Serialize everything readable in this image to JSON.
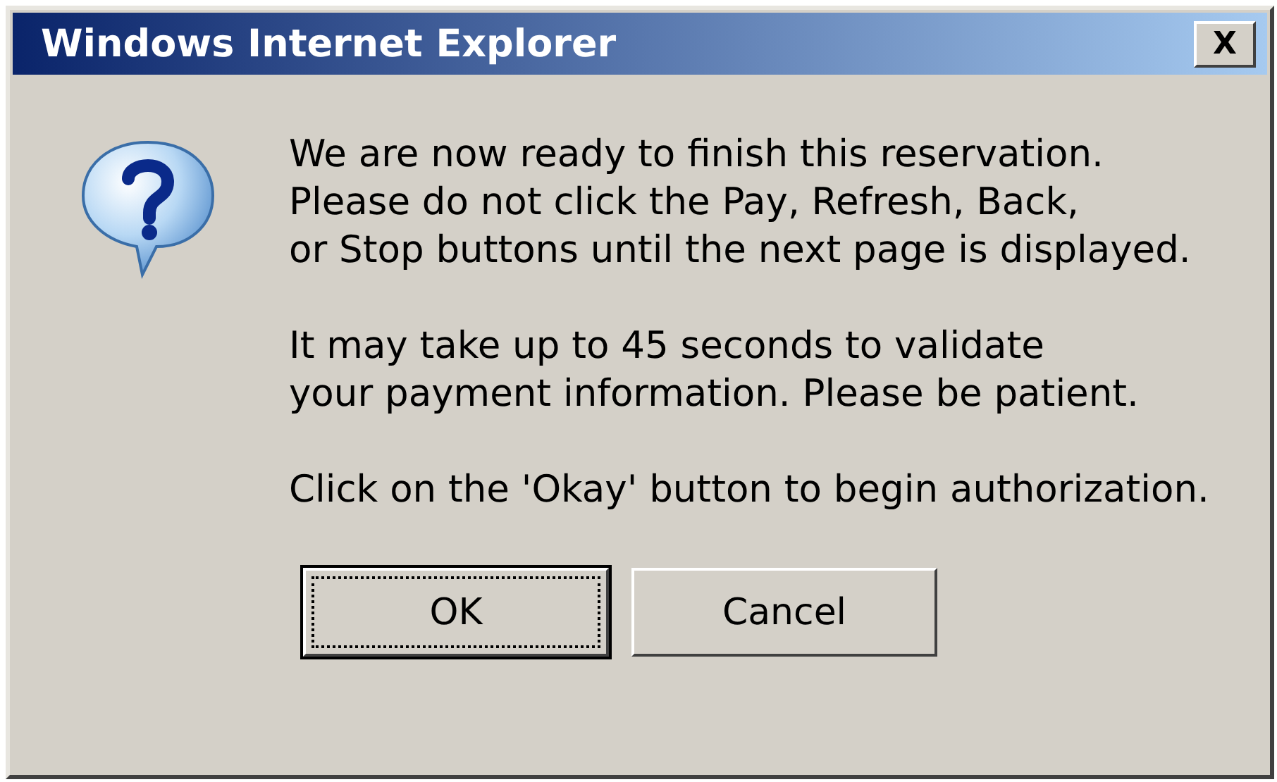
{
  "window": {
    "title": "Windows Internet Explorer",
    "close_label": "X"
  },
  "message": {
    "paragraphs": [
      "We are now ready to finish this reservation.\nPlease do not click the Pay, Refresh, Back,\nor Stop buttons until the next page is displayed.",
      "It may take up to 45 seconds to validate\nyour payment information. Please be patient.",
      "Click on the 'Okay' button to begin authorization."
    ]
  },
  "buttons": [
    {
      "label": "OK",
      "focused": true
    },
    {
      "label": "Cancel",
      "focused": false
    }
  ]
}
